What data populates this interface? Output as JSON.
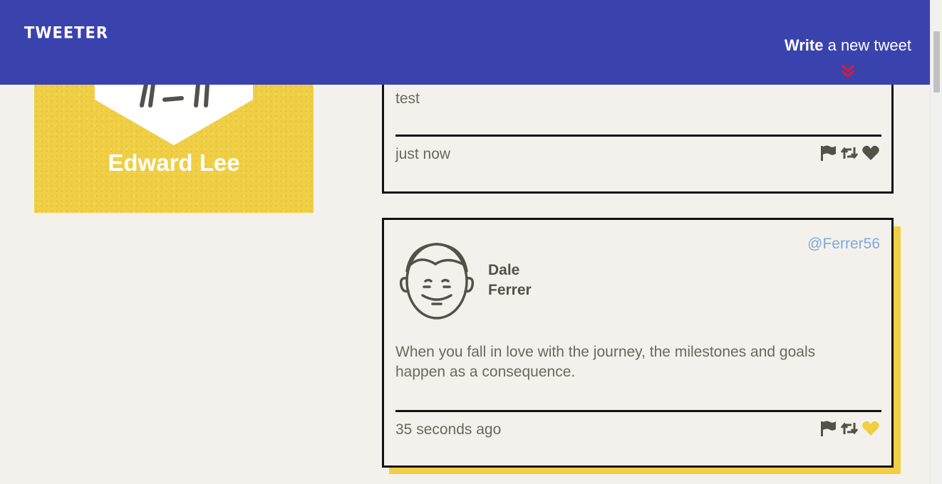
{
  "header": {
    "brand": "TWEETER",
    "compose_bold": "Write",
    "compose_rest": " a new tweet"
  },
  "profile": {
    "name": "Edward Lee"
  },
  "tweets": [
    {
      "text": "test",
      "time": "just now",
      "liked": false
    },
    {
      "author_first": "Dale",
      "author_last": "Ferrer",
      "handle": "@Ferrer56",
      "text_line1": "When you fall in love with the journey, the milestones and goals",
      "text_line2": "happen as a consequence.",
      "time": "35 seconds ago",
      "liked": true
    }
  ],
  "colors": {
    "header_bg": "#3a43ad",
    "profile_bg": "#f1cf45",
    "accent_red": "#d81b3a",
    "handle_blue": "#7eaadf",
    "icon_gray": "#545149",
    "liked_yellow": "#f1cf45"
  },
  "icons": [
    "double-chevron-down-icon",
    "flag-icon",
    "retweet-icon",
    "heart-icon"
  ]
}
